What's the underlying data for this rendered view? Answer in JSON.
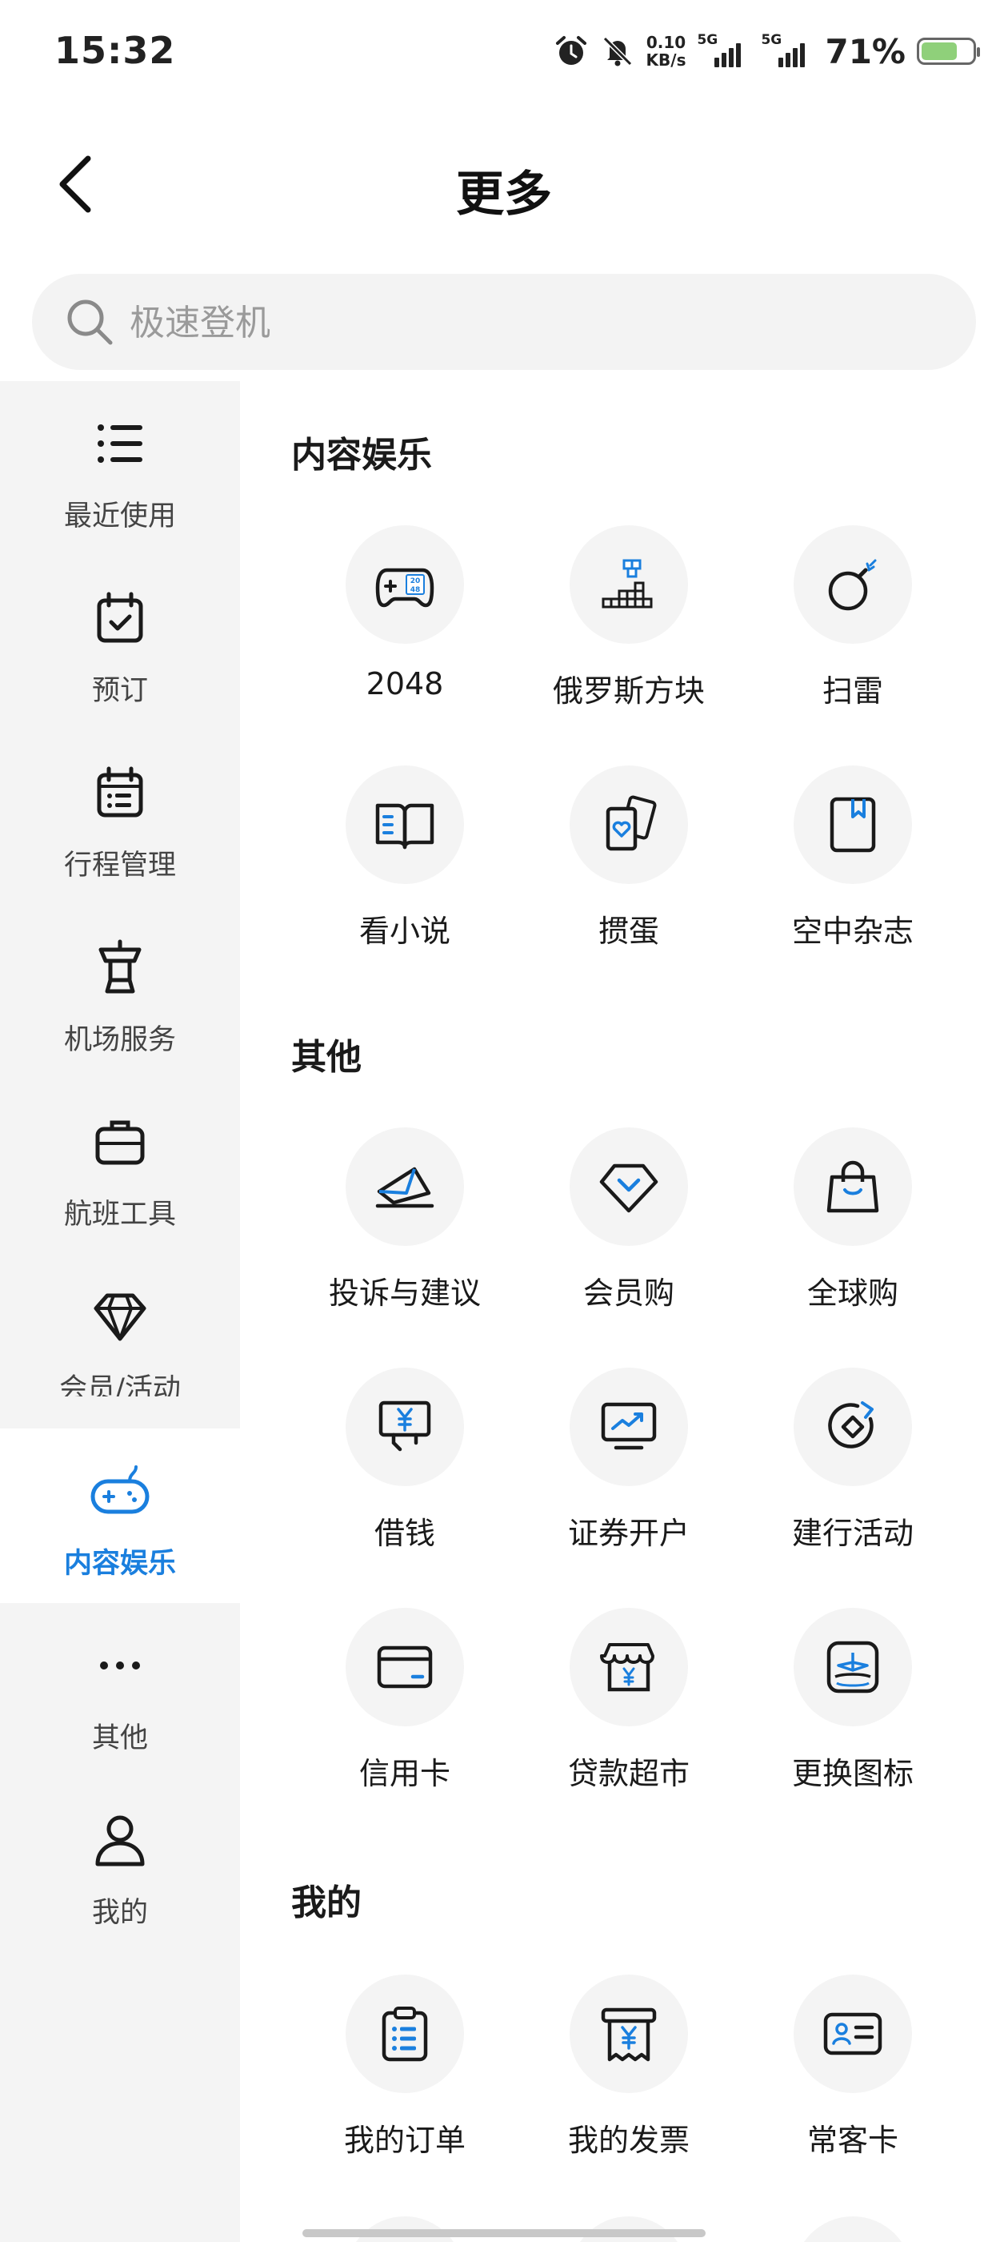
{
  "status_bar": {
    "time": "15:32",
    "net_speed_value": "0.10",
    "net_speed_unit": "KB/s",
    "sim1": "5G",
    "sim2": "5G",
    "battery_pct": "71%",
    "battery_level": 0.71
  },
  "header": {
    "title": "更多"
  },
  "search": {
    "placeholder": "极速登机"
  },
  "sidebar": {
    "items": [
      {
        "label": "最近使用",
        "icon": "list-icon"
      },
      {
        "label": "预订",
        "icon": "calendar-check-icon"
      },
      {
        "label": "行程管理",
        "icon": "schedule-icon"
      },
      {
        "label": "机场服务",
        "icon": "control-tower-icon"
      },
      {
        "label": "航班工具",
        "icon": "briefcase-icon"
      },
      {
        "label": "会员/活动",
        "icon": "diamond-icon"
      },
      {
        "label": "内容娱乐",
        "icon": "gamepad-icon",
        "active": true
      },
      {
        "label": "其他",
        "icon": "more-dots-icon"
      },
      {
        "label": "我的",
        "icon": "user-icon"
      }
    ]
  },
  "sections": [
    {
      "title": "内容娱乐",
      "items": [
        {
          "label": "2048",
          "icon": "game-2048-icon"
        },
        {
          "label": "俄罗斯方块",
          "icon": "tetris-icon"
        },
        {
          "label": "扫雷",
          "icon": "bomb-icon"
        },
        {
          "label": "看小说",
          "icon": "book-icon"
        },
        {
          "label": "掼蛋",
          "icon": "playing-cards-icon"
        },
        {
          "label": "空中杂志",
          "icon": "magazine-icon"
        }
      ]
    },
    {
      "title": "其他",
      "items": [
        {
          "label": "投诉与建议",
          "icon": "envelope-icon"
        },
        {
          "label": "会员购",
          "icon": "vip-diamond-icon"
        },
        {
          "label": "全球购",
          "icon": "shopping-bag-icon"
        },
        {
          "label": "借钱",
          "icon": "money-sign-icon"
        },
        {
          "label": "证券开户",
          "icon": "stock-monitor-icon"
        },
        {
          "label": "建行活动",
          "icon": "ccb-logo-icon"
        },
        {
          "label": "信用卡",
          "icon": "credit-card-icon"
        },
        {
          "label": "贷款超市",
          "icon": "loan-store-icon"
        },
        {
          "label": "更换图标",
          "icon": "app-icon-swap-icon"
        }
      ]
    },
    {
      "title": "我的",
      "items": [
        {
          "label": "我的订单",
          "icon": "order-clipboard-icon"
        },
        {
          "label": "我的发票",
          "icon": "invoice-icon"
        },
        {
          "label": "常客卡",
          "icon": "member-card-icon"
        }
      ]
    }
  ],
  "colors": {
    "accent": "#1a7fde",
    "sidebar_bg": "#f4f4f4",
    "circle_bg": "#f4f4f4"
  }
}
